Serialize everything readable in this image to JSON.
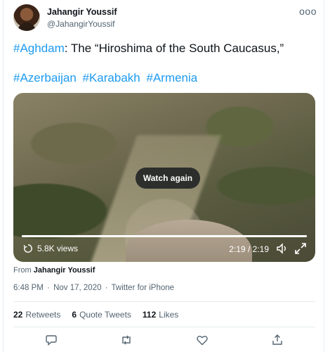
{
  "author": {
    "display_name": "Jahangir Youssif",
    "handle": "@JahangirYoussif"
  },
  "more_label": "ooo",
  "tweet": {
    "tag1": "#Aghdam",
    "text1": ": The “Hiroshima of the South Caucasus,”",
    "tags": [
      "#Azerbaijan",
      "#Karabakh",
      "#Armenia"
    ]
  },
  "video": {
    "watch_again_label": "Watch again",
    "views": "5.8K views",
    "time": "2:19 / 2:19",
    "progress_fraction": 1.0
  },
  "from": {
    "prefix": "From",
    "name": "Jahangir Youssif"
  },
  "meta": {
    "time": "6:48 PM",
    "sep1": "·",
    "date": "Nov 17, 2020",
    "sep2": "·",
    "source": "Twitter for iPhone"
  },
  "stats": {
    "retweets_count": "22",
    "retweets_label": "Retweets",
    "quotes_count": "6",
    "quotes_label": "Quote Tweets",
    "likes_count": "112",
    "likes_label": "Likes"
  },
  "icons": {
    "reply": "reply-icon",
    "retweet": "retweet-icon",
    "like": "like-icon",
    "share": "share-icon"
  },
  "colors": {
    "link": "#1d9bf0",
    "text": "#0f1419",
    "muted": "#536471"
  }
}
